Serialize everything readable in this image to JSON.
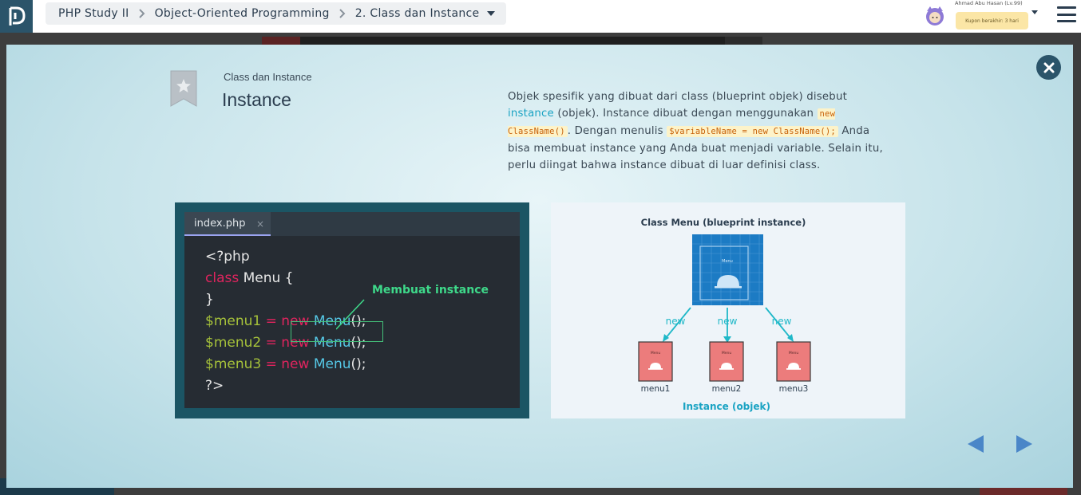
{
  "breadcrumb": {
    "course": "PHP Study II",
    "chapter": "Object-Oriented Programming",
    "lesson": "2. Class dan Instance"
  },
  "user": {
    "name": "Ahmad Abu Hasan (Lv.99)",
    "coupon": "Kupon berakhir: 3 hari"
  },
  "slide": {
    "subtitle": "Class dan Instance",
    "title": "Instance",
    "description": {
      "part1": "Objek spesifik yang dibuat dari class (blueprint objek) disebut ",
      "link": "instance",
      "part2": " (objek). Instance dibuat dengan menggunakan ",
      "code1": "new ClassName()",
      "part3": ". Dengan menulis ",
      "code2": "$variableName = new ClassName();",
      "part4": " Anda bisa membuat instance yang Anda buat menjadi variable. Selain itu, perlu diingat bahwa instance dibuat di luar definisi class."
    }
  },
  "code_panel": {
    "tab": "index.php",
    "tab_close": "×",
    "annotation": "Membuat instance",
    "lines": {
      "l1": "<?php",
      "l2_kw": "class",
      "l2_rest": " Menu {",
      "l3": "}",
      "l4_var": "$menu1",
      "l4_eq": " = ",
      "l4_new": "new",
      "l4_cls": "Menu",
      "l4_end": "();",
      "l5_var": "$menu2",
      "l5_eq": " = ",
      "l5_new": "new",
      "l5_cls": "Menu",
      "l5_end": "();",
      "l6_var": "$menu3",
      "l6_eq": " = ",
      "l6_new": "new",
      "l6_cls": "Menu",
      "l6_end": "();",
      "l7": "?>"
    }
  },
  "diagram": {
    "title": "Class Menu (blueprint instance)",
    "class_label": "Menu",
    "arrow_label": "new",
    "instances": [
      "menu1",
      "menu2",
      "menu3"
    ],
    "instance_label": "Menu",
    "footer": "Instance (objek)"
  },
  "colors": {
    "brand": "#2b546a",
    "link": "#1aa3c3",
    "accent_teal": "#1aa3c3"
  }
}
